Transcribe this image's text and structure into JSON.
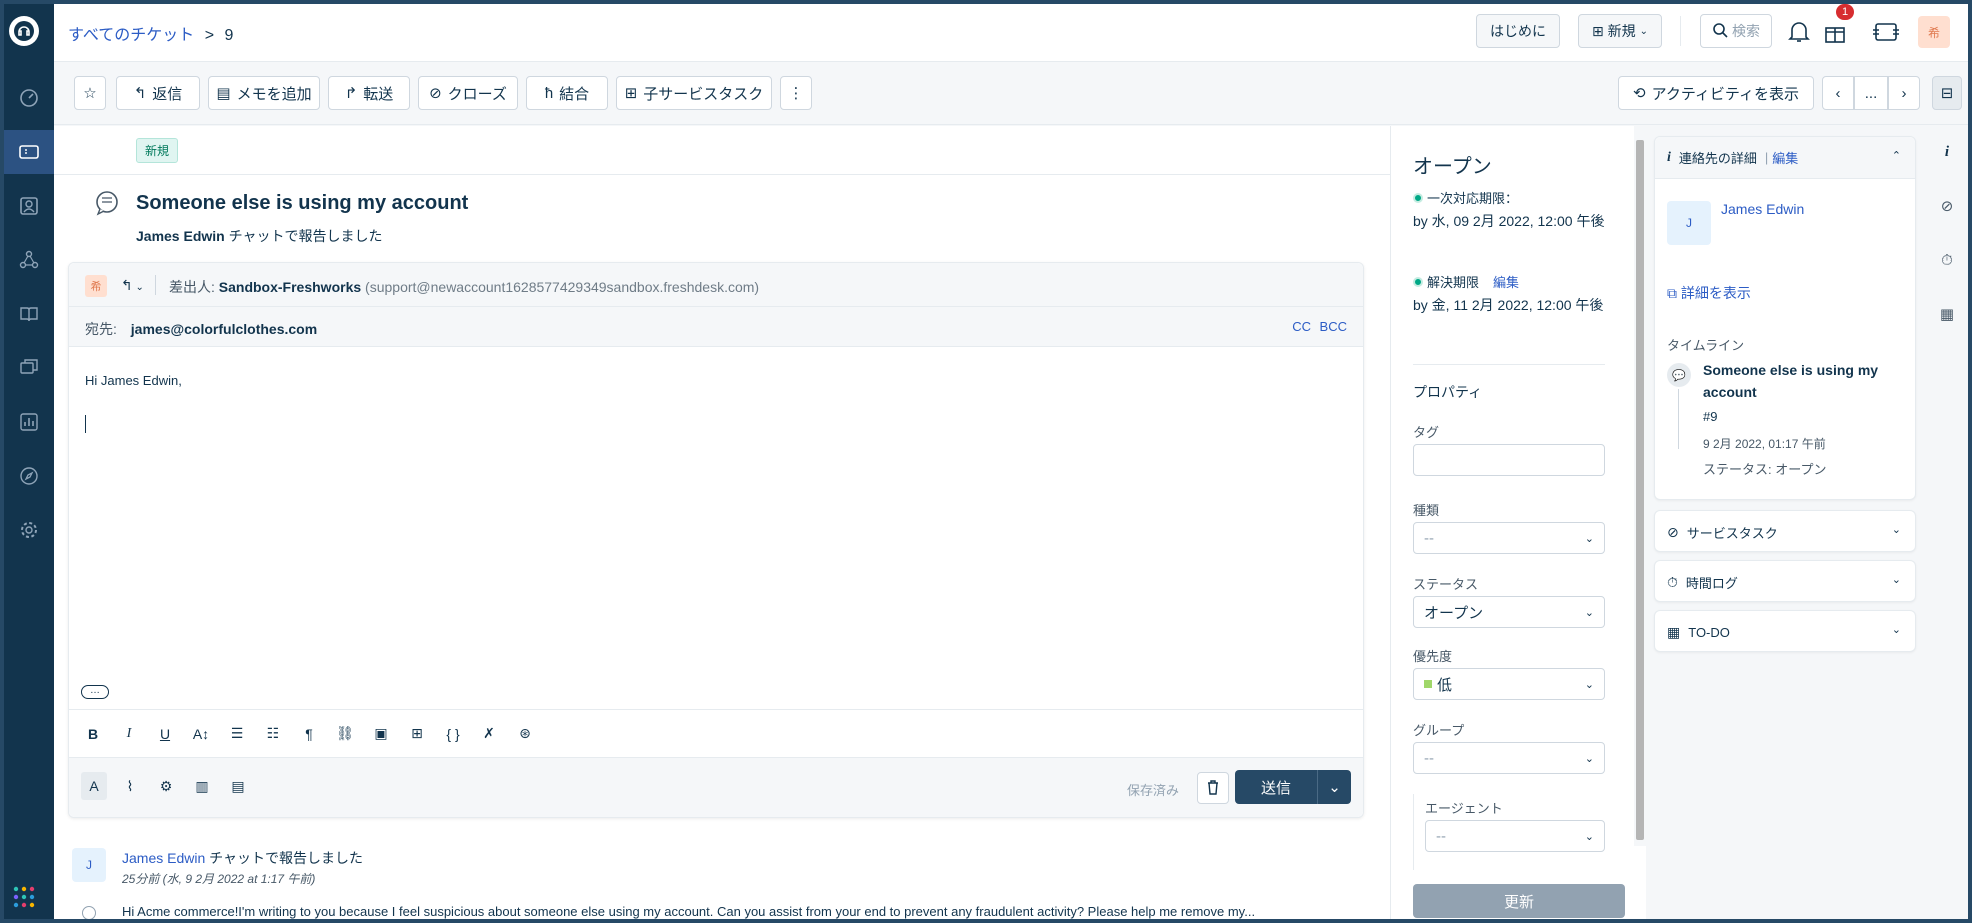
{
  "topbar": {
    "breadcrumb_link": "すべてのチケット",
    "breadcrumb_sep": ">",
    "ticket_number": "9",
    "getting_started": "はじめに",
    "new_label": "新規",
    "search_placeholder": "検索",
    "gift_badge": "1",
    "avatar_initial": "希"
  },
  "actions": {
    "reply": "返信",
    "add_note": "メモを追加",
    "forward": "転送",
    "close": "クローズ",
    "merge": "結合",
    "child_task": "子サービスタスク",
    "show_activity": "アクティビティを表示",
    "more": "..."
  },
  "ticket": {
    "badge": "新規",
    "subject": "Someone else is using my account",
    "requester": "James Edwin",
    "reported_via": "チャットで報告しました"
  },
  "editor": {
    "avatar_initial": "希",
    "from_label": "差出人:",
    "from_name": "Sandbox-Freshworks",
    "from_email": "(support@newaccount1628577429349sandbox.freshdesk.com)",
    "to_label": "宛先:",
    "to_email": "james@colorfulclothes.com",
    "cc": "CC",
    "bcc": "BCC",
    "greeting": "Hi James Edwin,",
    "saved": "保存済み",
    "send": "送信"
  },
  "conversation": {
    "avatar_initial": "J",
    "author": "James Edwin",
    "action": "チャットで報告しました",
    "time": "25分前 (水, 9 2月 2022 at 1:17 午前)",
    "preview": "Hi Acme commerce!I'm writing to you because I feel suspicious about someone else using my account. Can you assist from your end to prevent any fraudulent activity? Please help me remove my..."
  },
  "properties": {
    "status_title": "オープン",
    "first_response_label": "一次対応期限：",
    "first_response_value": "by 水, 09 2月 2022, 12:00 午後",
    "resolution_label": "解決期限",
    "resolution_edit": "編集",
    "resolution_value": "by 金, 11 2月 2022, 12:00 午後",
    "section_title": "プロパティ",
    "tag_label": "タグ",
    "type_label": "種類",
    "type_value": "--",
    "status_label": "ステータス",
    "status_value": "オープン",
    "priority_label": "優先度",
    "priority_value": "低",
    "group_label": "グループ",
    "group_value": "--",
    "agent_label": "エージェント",
    "agent_value": "--",
    "update_button": "更新"
  },
  "contact": {
    "header": "連絡先の詳細",
    "edit": "編集",
    "separator": "|",
    "avatar_initial": "J",
    "name": "James Edwin",
    "view_details": "詳細を表示",
    "timeline_label": "タイムライン",
    "timeline_subject": "Someone else is using my account",
    "timeline_id": "#9",
    "timeline_date": "9 2月 2022, 01:17 午前",
    "timeline_status": "ステータス: オープン"
  },
  "panels": {
    "service_tasks": "サービスタスク",
    "time_log": "時間ログ",
    "todo": "TO-DO"
  },
  "colors": {
    "sidebar": "#12344d",
    "link": "#2c5cc5",
    "send_button": "#264966",
    "sla_ok": "#00a886",
    "priority_low": "#a0d76a"
  }
}
